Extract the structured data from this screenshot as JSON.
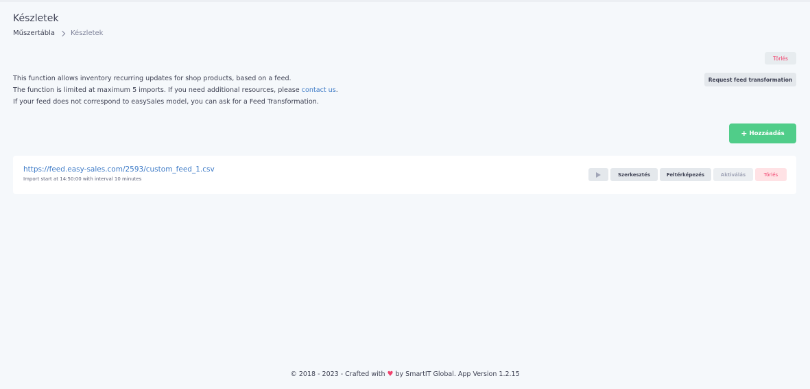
{
  "header": {
    "title": "Készletek",
    "breadcrumb": {
      "home": "Műszertábla",
      "current": "Készletek"
    }
  },
  "top_actions": {
    "delete_label": "Törlés",
    "request_label": "Request feed transformation"
  },
  "description": {
    "line1": "This function allows inventory recurring updates for shop products, based on a feed.",
    "line2_prefix": "The function is limited at maximum 5 imports. If you need additional resources, please ",
    "line2_link": "contact us",
    "line2_suffix": ".",
    "line3": "If your feed does not correspond to easySales model, you can ask for a Feed Transformation."
  },
  "add_button": {
    "icon": "plus-icon",
    "label": "Hozzáadás"
  },
  "feeds": [
    {
      "url": "https://feed.easy-sales.com/2593/custom_feed_1.csv",
      "meta": "Import start at 14:50:00 with interval 10 minutes",
      "actions": {
        "run_icon": "play-icon",
        "edit": "Szerkesztés",
        "process": "Feltérképezés",
        "activate": "Aktiválás",
        "delete": "Törlés"
      }
    }
  ],
  "footer": {
    "prefix": "© 2018 - 2023 - Crafted with ",
    "heart": "♥",
    "suffix": " by SmartIT Global. App Version 1.2.15"
  },
  "colors": {
    "accent_green": "#50cd89",
    "link_blue": "#3e7bc7",
    "danger": "#f1416c",
    "background": "#f5f8fb"
  }
}
